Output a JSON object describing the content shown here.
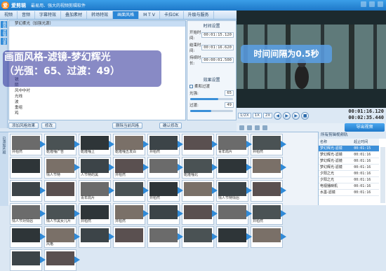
{
  "titlebar": {
    "app_name": "爱剪辑",
    "slogan": "最易用、强大的视频剪辑软件"
  },
  "tabs": [
    "视频",
    "音频",
    "字幕特效",
    "叠加素材",
    "转场特效",
    "画面风格",
    "M T V",
    "卡拉OK",
    "升级与服务"
  ],
  "active_tab_index": 5,
  "sidebar": {
    "labels": [
      "画面",
      "滤镜",
      "动景"
    ]
  },
  "effect_list": {
    "items": [
      "梦幻柔光（加强光源）",
      "",
      "",
      "",
      "",
      "",
      "",
      "",
      "",
      "",
      "锐",
      "阴",
      "风中中衬",
      "光线",
      "波",
      "重组",
      "鸡"
    ],
    "selected_index": 0
  },
  "time_settings": {
    "title": "时间设置",
    "start_label": "开始时间:",
    "start_value": "00:01:15.120",
    "end_label": "结束时间:",
    "end_value": "00:01:16.620",
    "duration_label": "持续时长:",
    "duration_value": "00:00:01.500"
  },
  "effect_settings": {
    "title": "效果设置",
    "soft_label": "柔和过渡",
    "strength_label": "光强:",
    "strength_value": "65",
    "transition_label": "过渡:",
    "transition_value": "49"
  },
  "buttons": {
    "add_style": "添加风格效果",
    "modify": "修改",
    "delete_style": "删除当前风格",
    "confirm": "确认修改",
    "export": "导出视频"
  },
  "overlays": {
    "purple_line1": "画面风格-滤镜-梦幻辉光",
    "purple_line2": "（光强：65、过渡：49）",
    "blue": "时间间隔为0.5秒"
  },
  "player": {
    "speeds": [
      "1/2X",
      "1X",
      "2X"
    ],
    "current_time": "00:01:16.120",
    "total_time": "00:02:35.440"
  },
  "timeline": {
    "side_label": "已添加片段",
    "clips": [
      "井柏然",
      "乾隆嘎广告",
      "乾隆嘎上",
      "乾隆嘎五发白",
      "井柏然",
      "",
      "青年局片",
      "井柏然",
      "",
      "情人节特",
      "人节特的黑",
      "井柏然",
      "",
      "乾隆嘎北",
      "",
      "",
      "",
      "",
      "青年局片",
      "",
      "井柏然",
      "",
      "情人节特情侣",
      "",
      "情人节对情侣",
      "情人节黑女儿片",
      "井柏然",
      "井柏然",
      "",
      "",
      "",
      "井柏然",
      "",
      "风格",
      "",
      "",
      "",
      "",
      "",
      "",
      "",
      ""
    ]
  },
  "subtitles": {
    "header": "所有剪辑视频轨",
    "columns": [
      "名称",
      "起止时间"
    ],
    "rows": [
      {
        "name": "梦幻辉光-滤镜",
        "time": "00:01:15"
      },
      {
        "name": "梦幻辉光-滤镜",
        "time": "00:01:16"
      },
      {
        "name": "梦幻辉光-滤镜",
        "time": "00:01:16"
      },
      {
        "name": "梦幻辉光-滤镜",
        "time": "00:01:16"
      },
      {
        "name": "夕阳之光",
        "time": "00:01:16"
      },
      {
        "name": "夕阳之光",
        "time": "00:01:16"
      },
      {
        "name": "电视播映机",
        "time": "00:01:16"
      },
      {
        "name": "水墨-滤镜",
        "time": "00:01:16"
      }
    ],
    "selected_index": 0
  }
}
